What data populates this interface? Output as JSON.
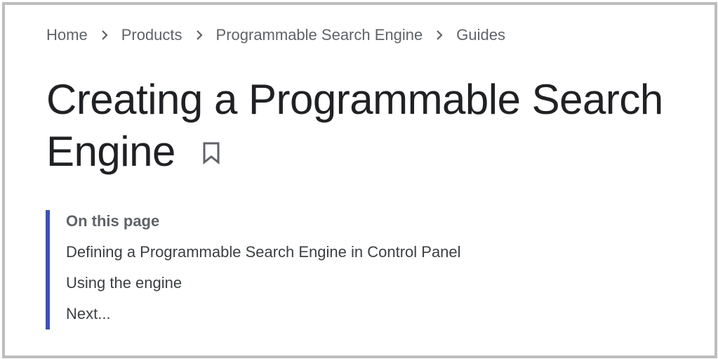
{
  "breadcrumb": {
    "items": [
      "Home",
      "Products",
      "Programmable Search Engine",
      "Guides"
    ]
  },
  "page": {
    "title": "Creating a Programmable Search Engine",
    "bookmark_icon": "bookmark-icon"
  },
  "toc": {
    "heading": "On this page",
    "items": [
      "Defining a Programmable Search Engine in Control Panel",
      "Using the engine",
      "Next..."
    ],
    "accent_color": "#3f51b5"
  },
  "colors": {
    "frame_border": "#bdbdbd",
    "breadcrumb_text": "#5f6368",
    "title_text": "#202124",
    "toc_text": "#3c4043"
  },
  "icons": {
    "separator": "chevron-right-icon",
    "bookmark": "bookmark-icon"
  }
}
